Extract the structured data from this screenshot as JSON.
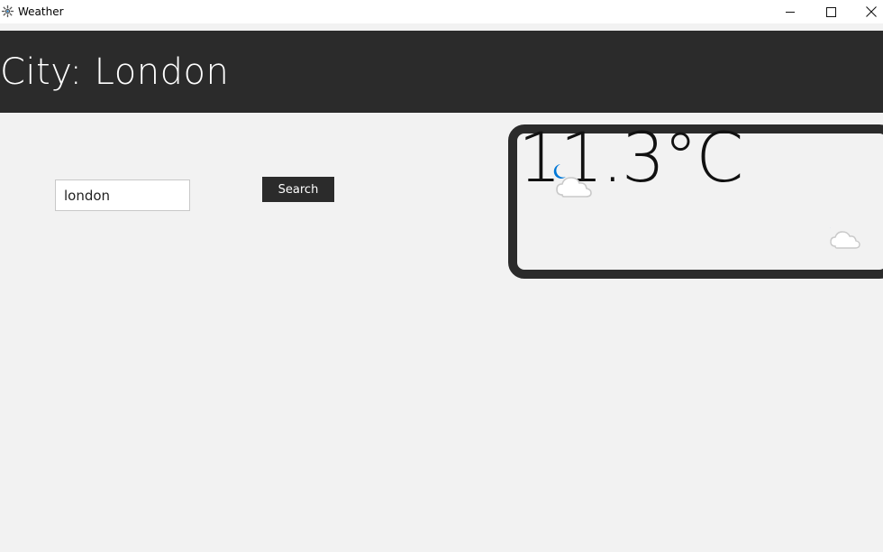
{
  "window": {
    "title": "Weather",
    "app_icon": "snowflake-gear-icon",
    "controls": {
      "minimize_icon": "minimize-icon",
      "maximize_icon": "maximize-icon",
      "close_icon": "close-icon"
    }
  },
  "header": {
    "city_title": "City: London",
    "background_color": "#2b2b2b"
  },
  "search": {
    "input_value": "london",
    "button_label": "Search"
  },
  "weather": {
    "temperature": "11.3°C",
    "condition_icon": "partly-cloudy-night-icon",
    "moon_color": "#0078d7"
  }
}
